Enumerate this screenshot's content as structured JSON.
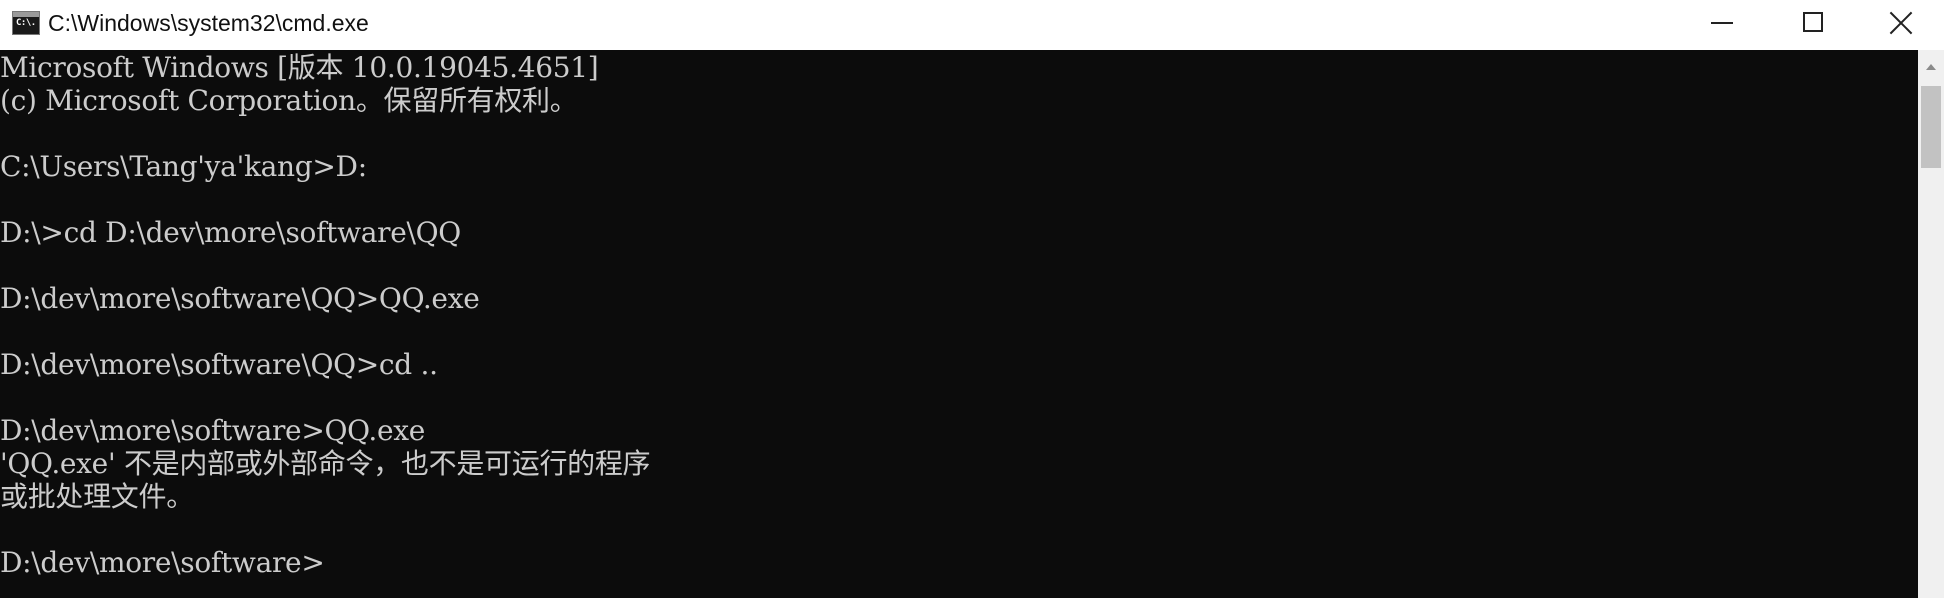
{
  "window": {
    "title": "C:\\Windows\\system32\\cmd.exe",
    "icon_text": "C:\\.",
    "icon": "cmd-app-icon",
    "controls": {
      "minimize": "minimize-icon",
      "maximize": "maximize-icon",
      "close": "close-icon"
    }
  },
  "console": {
    "lines": [
      "Microsoft Windows [版本 10.0.19045.4651]",
      "(c) Microsoft Corporation。保留所有权利。",
      "",
      "C:\\Users\\Tang'ya'kang>D:",
      "",
      "D:\\>cd D:\\dev\\more\\software\\QQ",
      "",
      "D:\\dev\\more\\software\\QQ>QQ.exe",
      "",
      "D:\\dev\\more\\software\\QQ>cd ..",
      "",
      "D:\\dev\\more\\software>QQ.exe",
      "'QQ.exe' 不是内部或外部命令，也不是可运行的程序",
      "或批处理文件。",
      "",
      "D:\\dev\\more\\software>"
    ]
  },
  "colors": {
    "console_bg": "#0c0c0c",
    "console_text": "#cccccc",
    "titlebar_bg": "#ffffff",
    "scrollbar_bg": "#f0f0f0",
    "scroll_thumb": "#c2c2c2"
  }
}
